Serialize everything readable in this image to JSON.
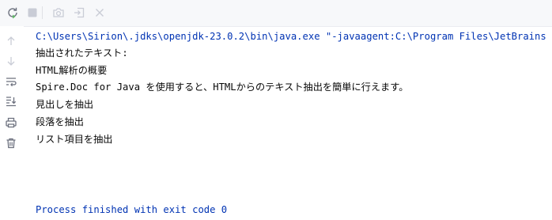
{
  "toolbar": {
    "buttons": [
      {
        "icon": "rerun-icon",
        "state": "enabled"
      },
      {
        "icon": "stop-icon",
        "state": "disabled"
      },
      {
        "icon": "camera-icon",
        "state": "disabled"
      },
      {
        "icon": "restore-layout-icon",
        "state": "disabled"
      },
      {
        "icon": "close-icon",
        "state": "disabled"
      }
    ]
  },
  "gutter": {
    "buttons": [
      {
        "icon": "up-arrow-icon"
      },
      {
        "icon": "down-arrow-icon"
      },
      {
        "icon": "soft-wrap-icon"
      },
      {
        "icon": "scroll-to-end-icon"
      },
      {
        "icon": "print-icon"
      },
      {
        "icon": "trash-icon"
      }
    ]
  },
  "console": {
    "command": "C:\\Users\\Sirion\\.jdks\\openjdk-23.0.2\\bin\\java.exe \"-javaagent:C:\\Program Files\\JetBrains",
    "output": [
      "抽出されたテキスト:",
      "HTML解析の概要",
      "Spire.Doc for Java を使用すると、HTMLからのテキスト抽出を簡単に行えます。",
      "見出しを抽出",
      "段落を抽出",
      "リスト項目を抽出"
    ],
    "exit_message": "Process finished with exit code 0"
  },
  "colors": {
    "command_text": "#0033b3",
    "output_text": "#080808",
    "icon_enabled": "#6c707e",
    "icon_disabled": "#c9ccd6",
    "run_green": "#5fb865"
  }
}
